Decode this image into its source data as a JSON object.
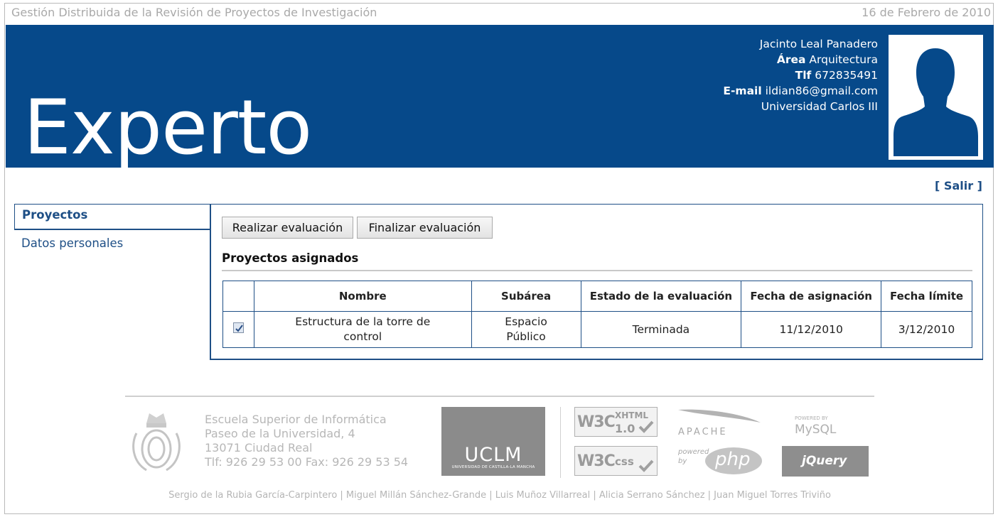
{
  "header": {
    "site_title": "Gestión Distribuida de la Revisión de Proyectos de Investigación",
    "date": "16 de Febrero de 2010"
  },
  "banner": {
    "role": "Experto",
    "user": {
      "name": "Jacinto Leal Panadero",
      "area_label": "Área",
      "area": "Arquitectura",
      "phone_label": "Tlf",
      "phone": "672835491",
      "email_label": "E-mail",
      "email": "ildian86@gmail.com",
      "university": "Universidad Carlos III"
    },
    "photo_icon": "user-silhouette",
    "bg_color": "#06498a"
  },
  "logout_label": "[ Salir ]",
  "sidebar": {
    "items": [
      {
        "label": "Proyectos",
        "active": true
      },
      {
        "label": "Datos personales",
        "active": false
      }
    ]
  },
  "main": {
    "buttons": {
      "evaluate": "Realizar evaluación",
      "finish": "Finalizar evaluación"
    },
    "section_title": "Proyectos asignados",
    "table": {
      "headers": [
        "",
        "Nombre",
        "Subárea",
        "Estado de la evaluación",
        "Fecha de asignación",
        "Fecha límite"
      ],
      "rows": [
        {
          "checked": true,
          "nombre": "Estructura de la torre de control",
          "subarea": "Espacio Público",
          "estado": "Terminada",
          "fecha_asignacion": "11/12/2010",
          "fecha_limite": "3/12/2010"
        }
      ]
    }
  },
  "footer": {
    "address": [
      "Escuela Superior de Informática",
      "Paseo de la Universidad, 4",
      "13071 Ciudad Real",
      "Tlf: 926 29 53 00 Fax: 926 29 53 54"
    ],
    "uclm": {
      "name": "UCLM",
      "sub": "UNIVERSIDAD DE CASTILLA-LA MANCHA"
    },
    "badges": {
      "xhtml_w3c": "W3C",
      "xhtml_label": "XHTML",
      "xhtml_version": "1.0",
      "apache": "APACHE",
      "mysql_powered": "POWERED BY",
      "mysql": "MySQL",
      "css_w3c": "W3C",
      "css_label": "css",
      "php_powered": "powered by",
      "php": "php",
      "jquery": "jQuery"
    },
    "credits": "Sergio de la Rubia García-Carpintero | Miguel Millán Sánchez-Grande | Luis Muñoz Villarreal | Alicia Serrano Sánchez | Juan Miguel Torres Triviño"
  }
}
